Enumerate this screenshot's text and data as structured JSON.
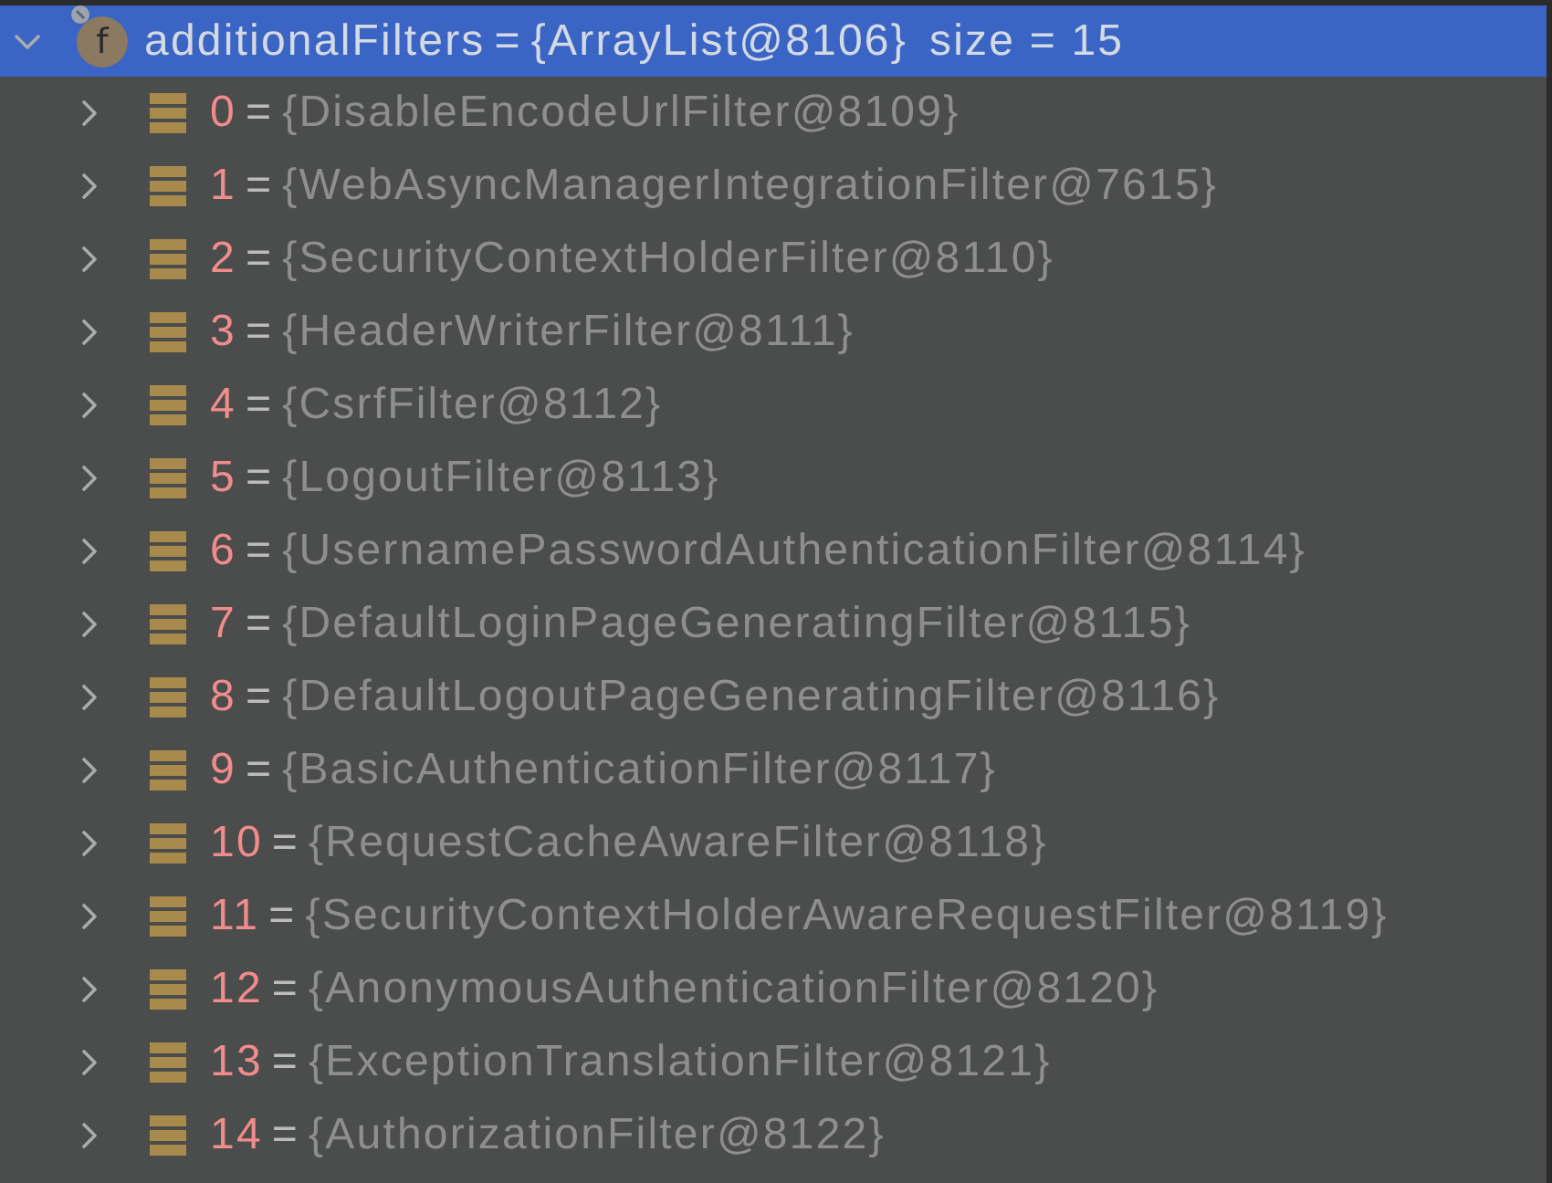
{
  "tree": {
    "name": "additionalFilters",
    "separator": "=",
    "value": "{ArrayList@8106}",
    "summary": "size = 15",
    "badge": "f",
    "expanded": true,
    "selected": true,
    "children": [
      {
        "index": "0",
        "separator": "=",
        "value": "{DisableEncodeUrlFilter@8109}",
        "expanded": false,
        "selected": false
      },
      {
        "index": "1",
        "separator": "=",
        "value": "{WebAsyncManagerIntegrationFilter@7615}",
        "expanded": false,
        "selected": false
      },
      {
        "index": "2",
        "separator": "=",
        "value": "{SecurityContextHolderFilter@8110}",
        "expanded": false,
        "selected": false
      },
      {
        "index": "3",
        "separator": "=",
        "value": "{HeaderWriterFilter@8111}",
        "expanded": false,
        "selected": false
      },
      {
        "index": "4",
        "separator": "=",
        "value": "{CsrfFilter@8112}",
        "expanded": false,
        "selected": false
      },
      {
        "index": "5",
        "separator": "=",
        "value": "{LogoutFilter@8113}",
        "expanded": false,
        "selected": false
      },
      {
        "index": "6",
        "separator": "=",
        "value": "{UsernamePasswordAuthenticationFilter@8114}",
        "expanded": false,
        "selected": false
      },
      {
        "index": "7",
        "separator": "=",
        "value": "{DefaultLoginPageGeneratingFilter@8115}",
        "expanded": false,
        "selected": false
      },
      {
        "index": "8",
        "separator": "=",
        "value": "{DefaultLogoutPageGeneratingFilter@8116}",
        "expanded": false,
        "selected": false
      },
      {
        "index": "9",
        "separator": "=",
        "value": "{BasicAuthenticationFilter@8117}",
        "expanded": false,
        "selected": false
      },
      {
        "index": "10",
        "separator": "=",
        "value": "{RequestCacheAwareFilter@8118}",
        "expanded": false,
        "selected": false
      },
      {
        "index": "11",
        "separator": "=",
        "value": "{SecurityContextHolderAwareRequestFilter@8119}",
        "expanded": false,
        "selected": false
      },
      {
        "index": "12",
        "separator": "=",
        "value": "{AnonymousAuthenticationFilter@8120}",
        "expanded": false,
        "selected": false
      },
      {
        "index": "13",
        "separator": "=",
        "value": "{ExceptionTranslationFilter@8121}",
        "expanded": false,
        "selected": false
      },
      {
        "index": "14",
        "separator": "=",
        "value": "{AuthorizationFilter@8122}",
        "expanded": false,
        "selected": false
      }
    ]
  }
}
